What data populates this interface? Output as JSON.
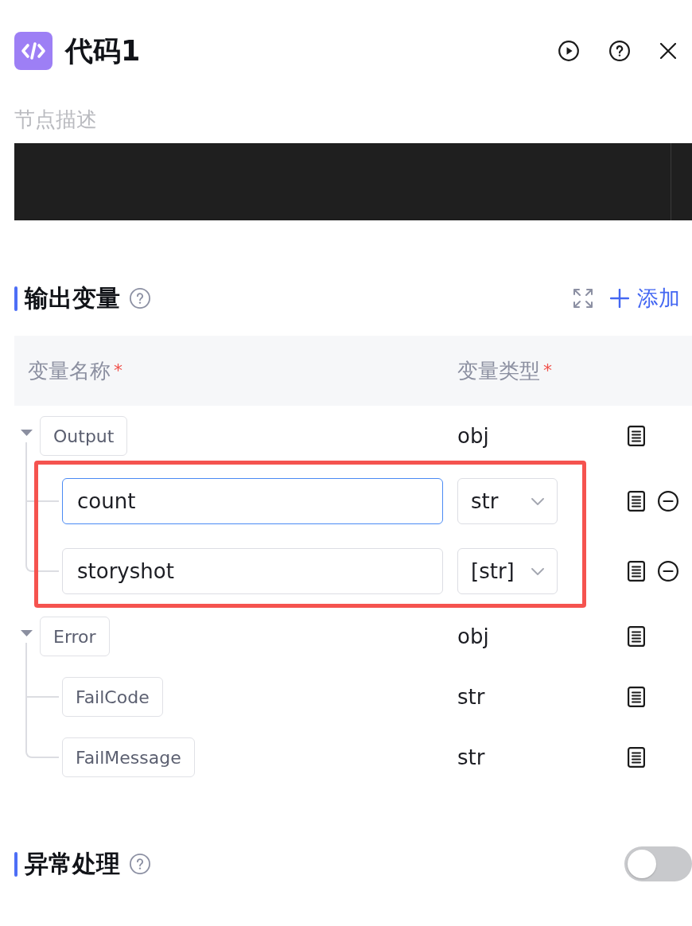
{
  "header": {
    "title": "代码1"
  },
  "description": {
    "placeholder": "节点描述"
  },
  "output_section": {
    "title": "输出变量",
    "add_label": "添加",
    "columns": [
      {
        "label": "变量名称",
        "mark": "*"
      },
      {
        "label": "变量类型",
        "mark": "*"
      }
    ],
    "variables": [
      {
        "kind": "fixed",
        "name": "Output",
        "type": "obj",
        "expanded": true,
        "highlighted": true,
        "children": [
          {
            "kind": "editable",
            "name": "count",
            "type": "str",
            "focused": true
          },
          {
            "kind": "editable",
            "name": "storyshot",
            "type": "[str]",
            "focused": false
          }
        ]
      },
      {
        "kind": "fixed",
        "name": "Error",
        "type": "obj",
        "expanded": true,
        "children": [
          {
            "kind": "fixed",
            "name": "FailCode",
            "type": "str"
          },
          {
            "kind": "fixed",
            "name": "FailMessage",
            "type": "str"
          }
        ]
      }
    ]
  },
  "exception_section": {
    "title": "异常处理",
    "on": false
  }
}
